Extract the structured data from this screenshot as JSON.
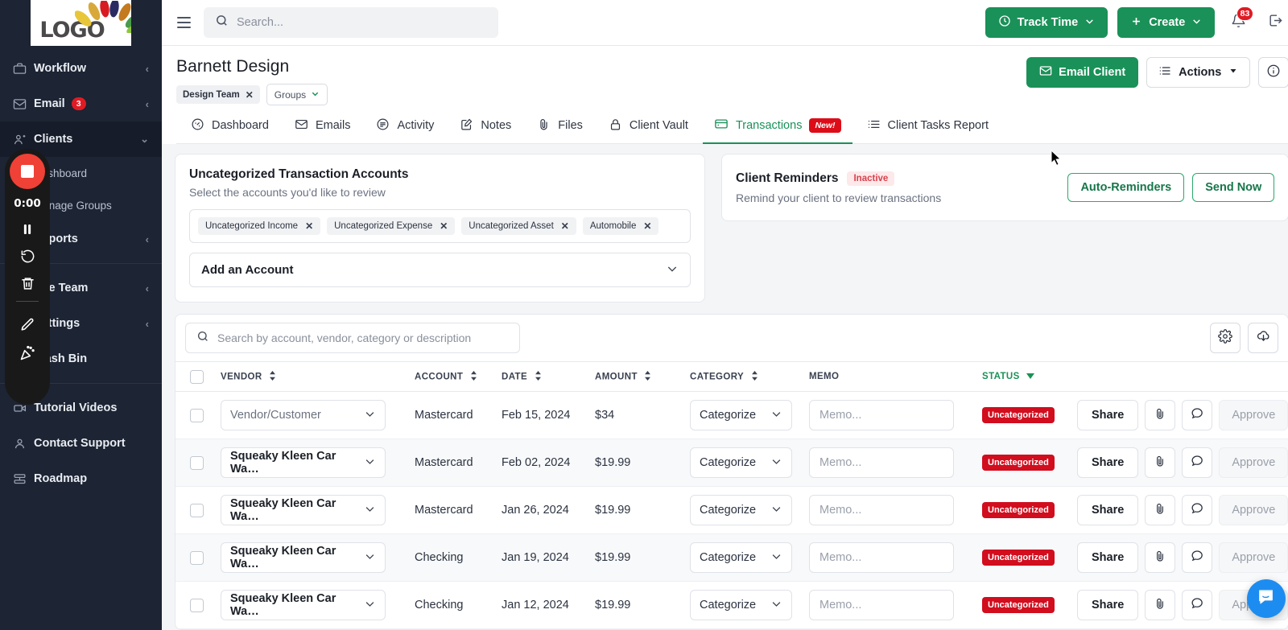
{
  "brand": {
    "logo_text": "LOGO",
    "accent_green": "#1a9158",
    "danger_red": "#d10d1e"
  },
  "sidebar": {
    "items": [
      {
        "label": "Workflow",
        "icon": "briefcase-icon",
        "chevron": "‹",
        "badge": ""
      },
      {
        "label": "Email",
        "icon": "envelope-icon",
        "chevron": "‹",
        "badge": "3"
      },
      {
        "label": "Clients",
        "icon": "clients-icon",
        "chevron": "⌄",
        "badge": ""
      }
    ],
    "sub_items": [
      {
        "label": "Dashboard"
      },
      {
        "label": "Manage Groups"
      }
    ],
    "items2": [
      {
        "label": "Reports",
        "icon": "reports-icon",
        "chevron": "‹"
      }
    ],
    "items3": [
      {
        "label": "Site Team",
        "icon": "team-icon",
        "chevron": "‹"
      },
      {
        "label": "Settings",
        "icon": "settings-icon",
        "chevron": "‹"
      },
      {
        "label": "Trash Bin",
        "icon": "trash-icon",
        "chevron": ""
      }
    ],
    "items4": [
      {
        "label": "Tutorial Videos",
        "icon": "video-icon"
      },
      {
        "label": "Contact Support",
        "icon": "person-icon"
      },
      {
        "label": "Roadmap",
        "icon": "roadmap-icon"
      }
    ]
  },
  "recorder": {
    "time": "0:00"
  },
  "topbar": {
    "search_placeholder": "Search...",
    "search_value": "",
    "track_time_label": "Track Time",
    "create_label": "Create",
    "notification_count": "83"
  },
  "header": {
    "title": "Barnett Design",
    "chip_label": "Design Team",
    "groups_label": "Groups",
    "email_client_label": "Email Client",
    "actions_label": "Actions"
  },
  "tabs": [
    {
      "label": "Dashboard",
      "icon": "dashboard-icon",
      "active": false,
      "badge": ""
    },
    {
      "label": "Emails",
      "icon": "envelope-icon",
      "active": false,
      "badge": ""
    },
    {
      "label": "Activity",
      "icon": "activity-icon",
      "active": false,
      "badge": ""
    },
    {
      "label": "Notes",
      "icon": "notes-icon",
      "active": false,
      "badge": ""
    },
    {
      "label": "Files",
      "icon": "paperclip-icon",
      "active": false,
      "badge": ""
    },
    {
      "label": "Client Vault",
      "icon": "lock-icon",
      "active": false,
      "badge": ""
    },
    {
      "label": "Transactions",
      "icon": "card-icon",
      "active": true,
      "badge": "New!"
    },
    {
      "label": "Client Tasks Report",
      "icon": "list-icon",
      "active": false,
      "badge": ""
    }
  ],
  "uncategorized_card": {
    "title": "Uncategorized Transaction Accounts",
    "subtitle": "Select the accounts you'd like to review",
    "tokens": [
      "Uncategorized Income",
      "Uncategorized Expense",
      "Uncategorized Asset",
      "Automobile"
    ],
    "add_account_label": "Add an Account"
  },
  "reminders_card": {
    "title": "Client Reminders",
    "status_badge": "Inactive",
    "subtitle": "Remind your client to review transactions",
    "auto_label": "Auto-Reminders",
    "send_label": "Send Now"
  },
  "table": {
    "search_placeholder": "Search by account, vendor, category or description",
    "search_value": "",
    "columns": [
      {
        "label": "VENDOR",
        "sort": "both"
      },
      {
        "label": "ACCOUNT",
        "sort": "both"
      },
      {
        "label": "DATE",
        "sort": "both"
      },
      {
        "label": "AMOUNT",
        "sort": "both"
      },
      {
        "label": "CATEGORY",
        "sort": "both"
      },
      {
        "label": "MEMO",
        "sort": "none"
      },
      {
        "label": "STATUS",
        "sort": "desc"
      }
    ],
    "category_placeholder": "Categorize",
    "memo_placeholder": "Memo...",
    "share_label": "Share",
    "approve_label": "Approve",
    "rows": [
      {
        "vendor": "Vendor/Customer",
        "vendor_is_placeholder": true,
        "account": "Mastercard",
        "date": "Feb 15, 2024",
        "amount": "$34",
        "category": "Categorize",
        "memo": "",
        "status": "Uncategorized"
      },
      {
        "vendor": "Squeaky Kleen Car Wa…",
        "vendor_is_placeholder": false,
        "account": "Mastercard",
        "date": "Feb 02, 2024",
        "amount": "$19.99",
        "category": "Categorize",
        "memo": "",
        "status": "Uncategorized"
      },
      {
        "vendor": "Squeaky Kleen Car Wa…",
        "vendor_is_placeholder": false,
        "account": "Mastercard",
        "date": "Jan 26, 2024",
        "amount": "$19.99",
        "category": "Categorize",
        "memo": "",
        "status": "Uncategorized"
      },
      {
        "vendor": "Squeaky Kleen Car Wa…",
        "vendor_is_placeholder": false,
        "account": "Checking",
        "date": "Jan 19, 2024",
        "amount": "$19.99",
        "category": "Categorize",
        "memo": "",
        "status": "Uncategorized"
      },
      {
        "vendor": "Squeaky Kleen Car Wa…",
        "vendor_is_placeholder": false,
        "account": "Checking",
        "date": "Jan 12, 2024",
        "amount": "$19.99",
        "category": "Categorize",
        "memo": "",
        "status": "Uncategorized"
      }
    ]
  }
}
